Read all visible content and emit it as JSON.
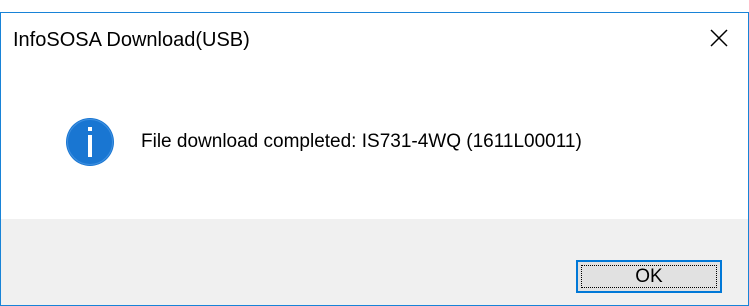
{
  "dialog": {
    "title": "InfoSOSA Download(USB)",
    "message": "File download completed: IS731-4WQ (1611L00011)",
    "ok_label": "OK",
    "icon": "info-icon",
    "close_icon": "close-icon"
  },
  "colors": {
    "border": "#1883d7",
    "footer_bg": "#f0f0f0",
    "icon_blue": "#1976d2",
    "button_border": "#0078d7",
    "button_bg": "#e1e1e1"
  }
}
